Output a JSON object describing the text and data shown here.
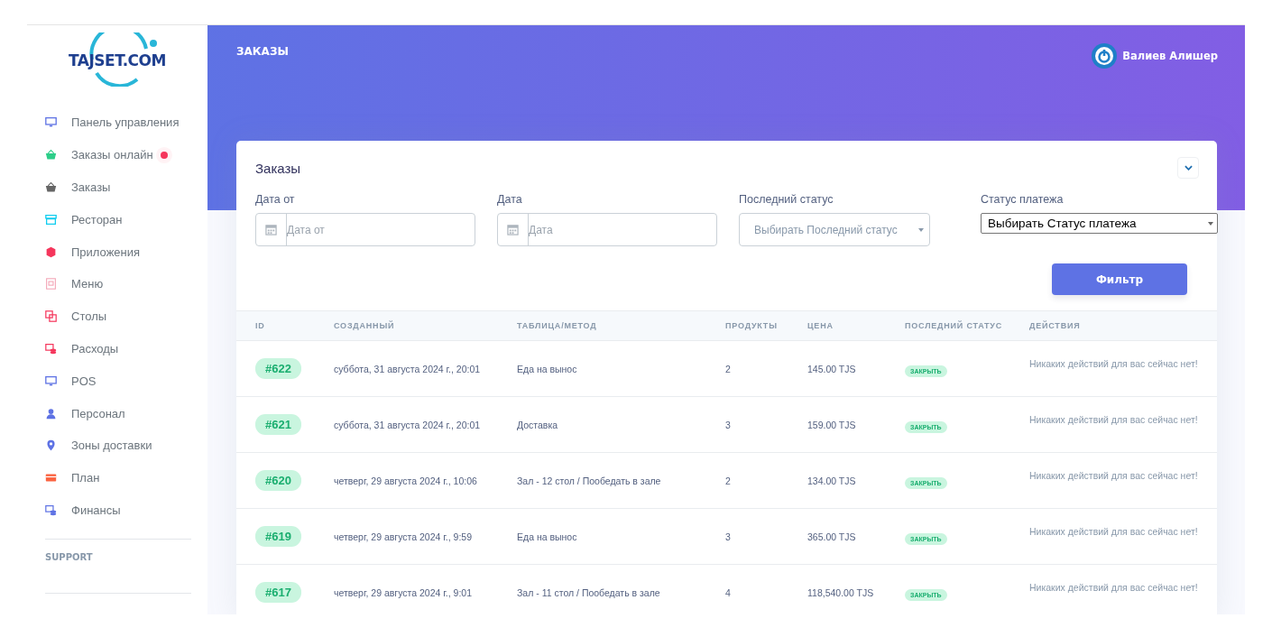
{
  "logo": {
    "text": "TAJSET.COM"
  },
  "sidebar": {
    "items": [
      {
        "label": "Панель управления",
        "badge": false
      },
      {
        "label": "Заказы онлайн",
        "badge": true
      },
      {
        "label": "Заказы",
        "badge": false
      },
      {
        "label": "Ресторан",
        "badge": false
      },
      {
        "label": "Приложения",
        "badge": false
      },
      {
        "label": "Меню",
        "badge": false
      },
      {
        "label": "Столы",
        "badge": false
      },
      {
        "label": "Расходы",
        "badge": false
      },
      {
        "label": "POS",
        "badge": false
      },
      {
        "label": "Персонал",
        "badge": false
      },
      {
        "label": "Зоны доставки",
        "badge": false
      },
      {
        "label": "План",
        "badge": false
      },
      {
        "label": "Финансы",
        "badge": false
      }
    ],
    "section": "SUPPORT"
  },
  "header": {
    "title": "ЗАКАЗЫ",
    "user": "Валиев Алишер"
  },
  "card": {
    "title": "Заказы",
    "filters": [
      {
        "kind": "date",
        "label": "Дата от",
        "placeholder": "Дата от"
      },
      {
        "kind": "date",
        "label": "Дата",
        "placeholder": "Дата"
      },
      {
        "kind": "select",
        "label": "Последний статус",
        "value": "Выбирать Последний статус"
      },
      {
        "kind": "native",
        "label": "Статус платежа",
        "value": "Выбирать Статус платежа"
      }
    ],
    "filter_button": "Фильтр",
    "table": {
      "columns": [
        "ID",
        "СОЗДАННЫЙ",
        "ТАБЛИЦА/МЕТОД",
        "ПРОДУКТЫ",
        "ЦЕНА",
        "ПОСЛЕДНИЙ СТАТУС",
        "ДЕЙСТВИЯ"
      ],
      "rows": [
        {
          "id": "#622",
          "created": "суббота, 31 августа 2024 г., 20:01",
          "method": "Еда на вынос",
          "products": "2",
          "price": "145.00 TJS",
          "status": "ЗАКРЫТЬ",
          "actions": "Никаких действий для вас сейчас нет!"
        },
        {
          "id": "#621",
          "created": "суббота, 31 августа 2024 г., 20:01",
          "method": "Доставка",
          "products": "3",
          "price": "159.00 TJS",
          "status": "ЗАКРЫТЬ",
          "actions": "Никаких действий для вас сейчас нет!"
        },
        {
          "id": "#620",
          "created": "четверг, 29 августа 2024 г., 10:06",
          "method": "Зал - 12 стол / Пообедать в зале",
          "products": "2",
          "price": "134.00 TJS",
          "status": "ЗАКРЫТЬ",
          "actions": "Никаких действий для вас сейчас нет!"
        },
        {
          "id": "#619",
          "created": "четверг, 29 августа 2024 г., 9:59",
          "method": "Еда на вынос",
          "products": "3",
          "price": "365.00 TJS",
          "status": "ЗАКРЫТЬ",
          "actions": "Никаких действий для вас сейчас нет!"
        },
        {
          "id": "#617",
          "created": "четверг, 29 августа 2024 г., 9:01",
          "method": "Зал - 11 стол / Пообедать в зале",
          "products": "4",
          "price": "118,540.00 TJS",
          "status": "ЗАКРЫТЬ",
          "actions": "Никаких действий для вас сейчас нет!"
        }
      ]
    }
  }
}
